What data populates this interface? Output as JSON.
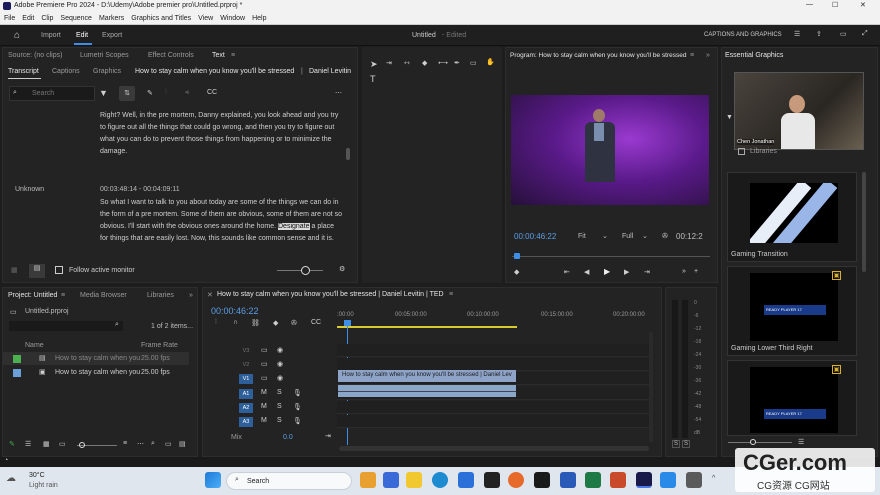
{
  "window": {
    "title": "Adobe Premiere Pro 2024 - D:\\Udemy\\Adobe premier pro\\Untitled.prproj *",
    "min": "—",
    "max": "☐",
    "close": "✕"
  },
  "menu": [
    "File",
    "Edit",
    "Clip",
    "Sequence",
    "Markers",
    "Graphics and Titles",
    "View",
    "Window",
    "Help"
  ],
  "appbar": {
    "tabs": [
      "Import",
      "Edit",
      "Export"
    ],
    "doc_title": "Untitled",
    "doc_status": "- Edited",
    "captions_label": "CAPTIONS AND GRAPHICS"
  },
  "source_tabs": [
    "Source: (no clips)",
    "Lumetri Scopes",
    "Effect Controls",
    "Text"
  ],
  "text_tabs": [
    "Transcript",
    "Captions",
    "Graphics",
    "How to stay calm when you know you'll be stressed",
    "Daniel Levitin"
  ],
  "search": {
    "placeholder": "Search"
  },
  "transcript": {
    "para1": "Right? Well, in the pre mortem, Danny explained, you look ahead and you try to figure out all the things that could go wrong, and then you try to figure out what you can do to prevent those things from happening or to minimize the damage.",
    "speaker": "Unknown",
    "time": "00:03:48:14 - 00:04:09:11",
    "para2a": "So what I want to talk to you about today are some of the things we can do in the form of a pre mortem. Some of them are obvious, some of them are not so obvious. I'll start with the obvious ones around the home. ",
    "para2hl": "Designate",
    "para2b": " a place for things that are easily lost. Now, this sounds like common sense and it is.",
    "follow": "Follow active monitor"
  },
  "program": {
    "title": "Program: How to stay calm when you know you'll be stressed",
    "timecode": "00:00:46:22",
    "fit": "Fit",
    "quality": "Full",
    "duration": "00:12:2"
  },
  "essential": {
    "title": "Essential Graphics",
    "webcam_name": "Chen Jonathan",
    "libraries": "Libraries",
    "cards": [
      "Gaming Transition",
      "Gaming Lower Third Right",
      ""
    ],
    "card_badge": "READY PLAYER 17"
  },
  "project": {
    "tabs": [
      "Project: Untitled",
      "Media Browser",
      "Libraries"
    ],
    "file": "Untitled.prproj",
    "count": "1 of 2 items...",
    "col_name": "Name",
    "col_fps": "Frame Rate",
    "items": [
      {
        "name": "How to stay calm when you",
        "fps": "25.00 fps",
        "color": "#4caf50"
      },
      {
        "name": "How to stay calm when you",
        "fps": "25.00 fps",
        "color": "#6a9fd8"
      }
    ]
  },
  "timeline": {
    "tab": "How to stay calm when you know you'll be stressed | Daniel Levitin | TED",
    "timecode": "00:00:46:22",
    "ruler": [
      ":00:00",
      "00:05:00:00",
      "00:10:00:00",
      "00:15:00:00",
      "00:20:00:00"
    ],
    "tracks": [
      "V3",
      "V2",
      "V1",
      "A1",
      "A2",
      "A3"
    ],
    "mix": "Mix",
    "mix_val": "0.0",
    "clip_label": "How to stay calm when you know you'll be stressed | Daniel Lev",
    "meter": [
      "0",
      "-6",
      "-12",
      "-18",
      "-24",
      "-30",
      "-36",
      "-42",
      "-48",
      "-54",
      "dB"
    ]
  },
  "statusbar": {
    "weather_temp": "30°C",
    "weather": "Light rain"
  },
  "taskbar": {
    "search": "Search"
  },
  "watermark": {
    "big": "CGer.com",
    "small": "CG资源 CG网站"
  }
}
